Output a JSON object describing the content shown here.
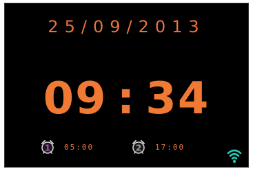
{
  "display": {
    "date": "25/09/2013",
    "time_hours": "09",
    "time_separator": ":",
    "time_minutes": "34"
  },
  "alarms": [
    {
      "number": "1",
      "time": "05:00",
      "icon": "alarm-clock-icon",
      "badge_color": "#c33fd8"
    },
    {
      "number": "2",
      "time": "17:00",
      "icon": "alarm-clock-icon",
      "badge_color": "#9aa0a6"
    }
  ],
  "status": {
    "wifi_icon": "wifi-icon",
    "wifi_color": "#27c7b8"
  },
  "colors": {
    "accent": "#f07a34",
    "background": "#000000"
  }
}
